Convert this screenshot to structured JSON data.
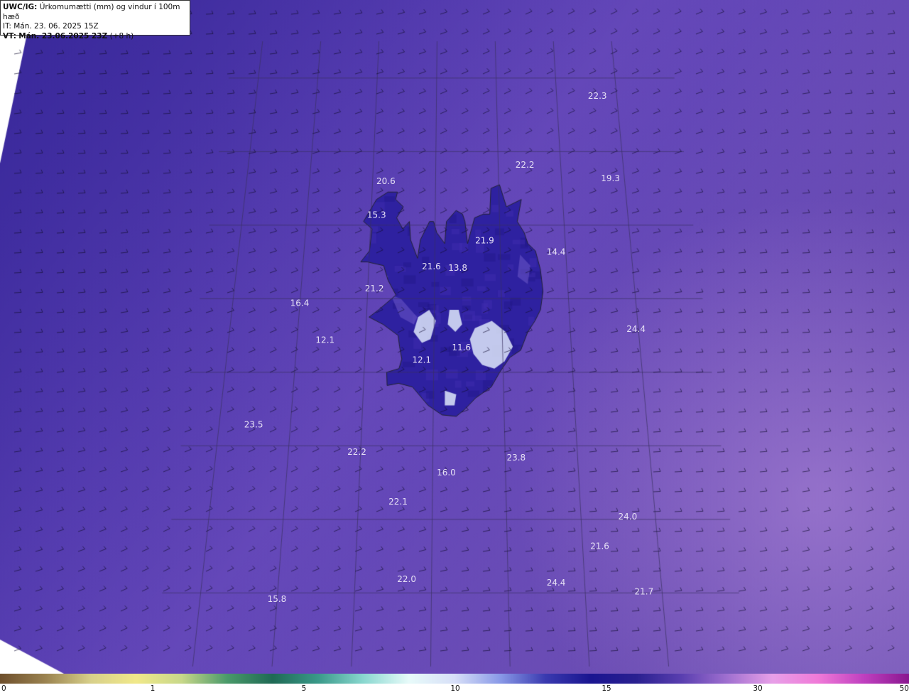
{
  "header": {
    "model": "UWC/IG:",
    "field": "Úrkomumætti (mm) og vindur í 100m hæð",
    "init_line": "IT: Mán. 23. 06. 2025 15Z",
    "valid_prefix": "VT:",
    "valid_time": "Mán. 23.06.2025 23Z",
    "lead": "(+8 h)"
  },
  "map_labels": [
    {
      "text": "22.3",
      "lon": -9.3,
      "lat": 67.72
    },
    {
      "text": "22.2",
      "lon": -14.3,
      "lat": 66.78
    },
    {
      "text": "19.3",
      "lon": -8.9,
      "lat": 66.6
    },
    {
      "text": "20.6",
      "lon": -23.15,
      "lat": 66.56
    },
    {
      "text": "15.3",
      "lon": -23.65,
      "lat": 66.1
    },
    {
      "text": "21.9",
      "lon": -16.95,
      "lat": 65.75
    },
    {
      "text": "14.4",
      "lon": -12.6,
      "lat": 65.6
    },
    {
      "text": "21.6",
      "lon": -20.2,
      "lat": 65.4
    },
    {
      "text": "13.8",
      "lon": -18.6,
      "lat": 65.38
    },
    {
      "text": "21.2",
      "lon": -23.6,
      "lat": 65.1
    },
    {
      "text": "16.4",
      "lon": -28.0,
      "lat": 64.9
    },
    {
      "text": "24.4",
      "lon": -8.15,
      "lat": 64.55
    },
    {
      "text": "12.1",
      "lon": -26.35,
      "lat": 64.4
    },
    {
      "text": "11.6",
      "lon": -18.4,
      "lat": 64.3
    },
    {
      "text": "12.1",
      "lon": -20.7,
      "lat": 64.13
    },
    {
      "text": "23.5",
      "lon": -30.05,
      "lat": 63.25
    },
    {
      "text": "22.2",
      "lon": -24.2,
      "lat": 62.88
    },
    {
      "text": "23.8",
      "lon": -15.4,
      "lat": 62.8
    },
    {
      "text": "16.0",
      "lon": -19.25,
      "lat": 62.6
    },
    {
      "text": "22.1",
      "lon": -21.85,
      "lat": 62.2
    },
    {
      "text": "24.0",
      "lon": -9.5,
      "lat": 62.0
    },
    {
      "text": "21.6",
      "lon": -11.1,
      "lat": 61.6
    },
    {
      "text": "22.0",
      "lon": -21.3,
      "lat": 61.15
    },
    {
      "text": "24.4",
      "lon": -13.5,
      "lat": 61.1
    },
    {
      "text": "15.8",
      "lon": -28.0,
      "lat": 60.88
    },
    {
      "text": "21.7",
      "lon": -8.95,
      "lat": 60.98
    }
  ],
  "colorbar": {
    "ticks": [
      {
        "label": "0",
        "value": 0
      },
      {
        "label": "1",
        "value": 1
      },
      {
        "label": "5",
        "value": 5
      },
      {
        "label": "10",
        "value": 10
      },
      {
        "label": "15",
        "value": 15
      },
      {
        "label": "30",
        "value": 30
      },
      {
        "label": "50",
        "value": 50
      }
    ],
    "colors": [
      "#6e4f2c",
      "#9b8350",
      "#d8d08a",
      "#f1e98a",
      "#c8d88a",
      "#4a9a6a",
      "#1f6a55",
      "#3a9a8a",
      "#8ad8d0",
      "#e8fbfa",
      "#d8e0f8",
      "#8a9ae8",
      "#3a3ab0",
      "#1a1590",
      "#2a2090",
      "#5a3fb0",
      "#a070d0",
      "#e8a0e8",
      "#f07ad8",
      "#c040c0",
      "#8a1890"
    ]
  },
  "colors": {
    "ocean_low": "#4e38a8",
    "ocean_high": "#8a64c6",
    "land": "#2e21a0",
    "glacier": "#dde6fa",
    "coast": "#222233",
    "grid": "#3a3060"
  }
}
